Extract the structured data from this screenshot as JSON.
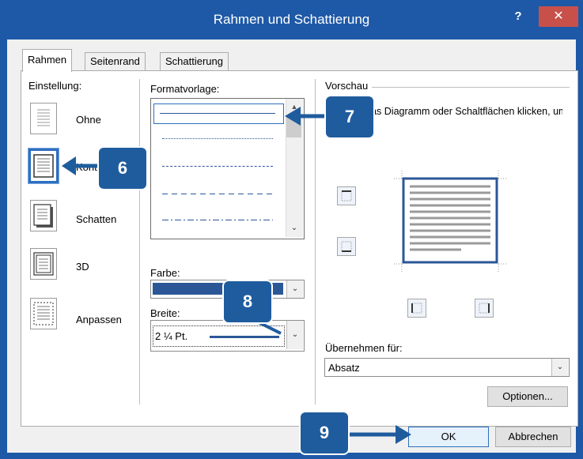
{
  "window": {
    "title": "Rahmen und Schattierung",
    "help": "?",
    "close": "✕"
  },
  "tabs": [
    "Rahmen",
    "Seitenrand",
    "Schattierung"
  ],
  "einstellung": {
    "label": "Einstellung:",
    "items": [
      "Ohne",
      "Kontur",
      "Schatten",
      "3D",
      "Anpassen"
    ]
  },
  "formatvorlage": {
    "label": "Formatvorlage:"
  },
  "farbe": {
    "label": "Farbe:",
    "color": "#2b5797"
  },
  "breite": {
    "label": "Breite:",
    "value": "2 ¼ Pt."
  },
  "vorschau": {
    "label": "Vorschau",
    "hint": "Klicken Sie auf das Diagramm oder Schaltflächen klicken, um Rahmen hinzuzufügen"
  },
  "uebernehmen": {
    "label": "Übernehmen für:",
    "value": "Absatz"
  },
  "buttons": {
    "optionen": "Optionen...",
    "ok": "OK",
    "abbrechen": "Abbrechen"
  },
  "callouts": [
    "6",
    "7",
    "8",
    "9"
  ]
}
